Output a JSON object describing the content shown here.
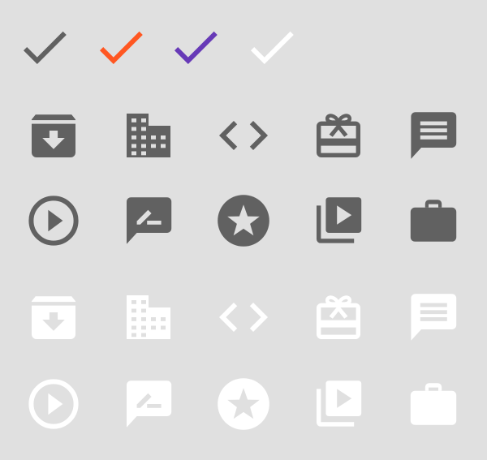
{
  "colors": {
    "background": "#e0e0e0",
    "dark": "#616161",
    "light": "#ffffff",
    "orange": "#ff5722",
    "purple": "#673ab7"
  },
  "check_row": [
    {
      "icon": "check-icon",
      "color": "#616161"
    },
    {
      "icon": "check-icon",
      "color": "#ff5722"
    },
    {
      "icon": "check-icon",
      "color": "#673ab7"
    },
    {
      "icon": "check-icon",
      "color": "#ffffff"
    }
  ],
  "icon_sets": [
    {
      "theme": "dark",
      "color": "#616161",
      "rows": [
        [
          "archive-icon",
          "business-icon",
          "code-icon",
          "card-giftcard-icon",
          "chat-icon"
        ],
        [
          "play-circle-outline-icon",
          "rate-review-icon",
          "stars-icon",
          "video-library-icon",
          "work-icon"
        ]
      ]
    },
    {
      "theme": "light",
      "color": "#ffffff",
      "rows": [
        [
          "archive-icon",
          "business-icon",
          "code-icon",
          "card-giftcard-icon",
          "chat-icon"
        ],
        [
          "play-circle-outline-icon",
          "rate-review-icon",
          "stars-icon",
          "video-library-icon",
          "work-icon"
        ]
      ]
    }
  ]
}
